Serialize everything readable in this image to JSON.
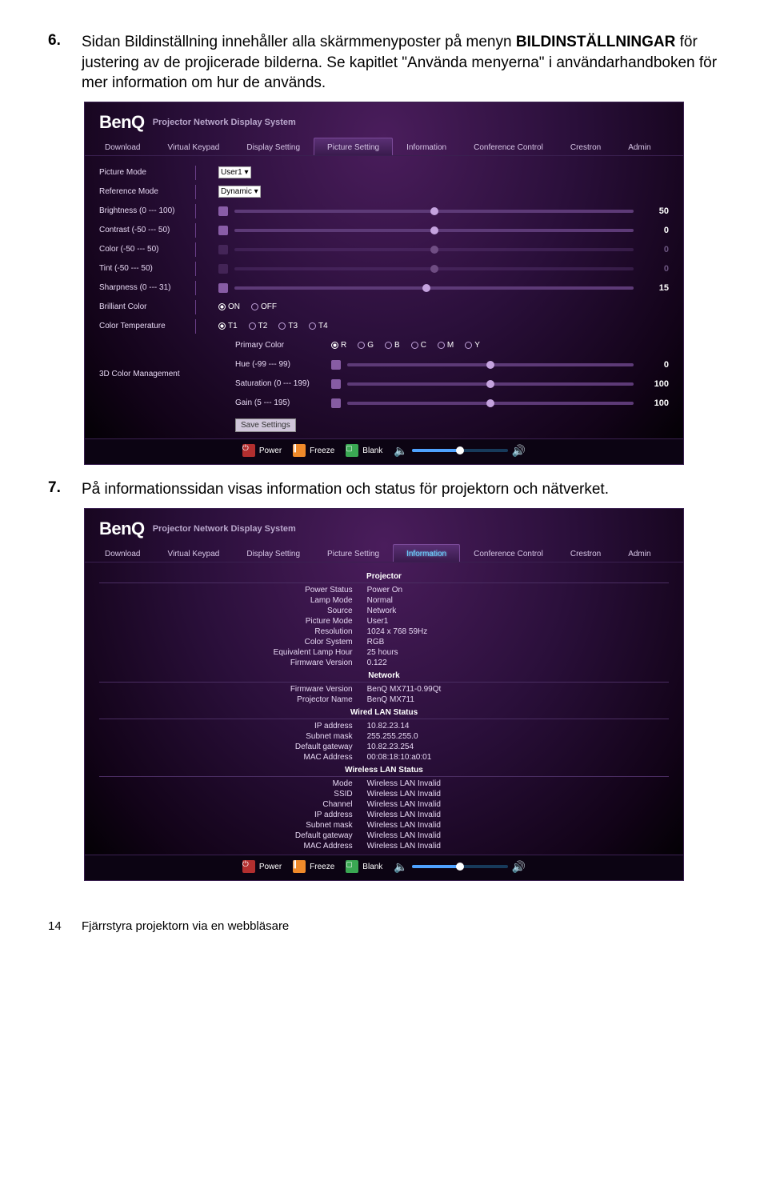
{
  "page": {
    "item6_num": "6.",
    "item6_text_a": "Sidan Bildinställning innehåller alla skärmmenyposter på menyn ",
    "item6_text_b": "BILDINSTÄLLNINGAR",
    "item6_text_c": " för justering av de projicerade bilderna. Se kapitlet \"Använda menyerna\" i användarhandboken för mer information om hur de används.",
    "item7_num": "7.",
    "item7_text": "På informationssidan visas information och status för projektorn och nätverket.",
    "footer_pagenum": "14",
    "footer_chapter": "Fjärrstyra projektorn via en webbläsare"
  },
  "shot1": {
    "logo": "BenQ",
    "subtitle": "Projector Network Display System",
    "tabs": [
      "Download",
      "Virtual Keypad",
      "Display Setting",
      "Picture Setting",
      "Information",
      "Conference Control",
      "Crestron",
      "Admin"
    ],
    "active_tab": "Picture Setting",
    "picture_mode_label": "Picture Mode",
    "picture_mode_value": "User1",
    "reference_mode_label": "Reference Mode",
    "reference_mode_value": "Dynamic",
    "brightness_label": "Brightness (0 --- 100)",
    "brightness_value": "50",
    "contrast_label": "Contrast (-50 --- 50)",
    "contrast_value": "0",
    "color_label": "Color (-50 --- 50)",
    "color_value": "0",
    "tint_label": "Tint (-50 --- 50)",
    "tint_value": "0",
    "sharpness_label": "Sharpness (0 --- 31)",
    "sharpness_value": "15",
    "brilliant_label": "Brilliant Color",
    "brilliant_options": [
      "ON",
      "OFF"
    ],
    "ctemp_label": "Color Temperature",
    "ctemp_options": [
      "T1",
      "T2",
      "T3",
      "T4"
    ],
    "group3d_label": "3D Color Management",
    "primary_label": "Primary Color",
    "primary_options": [
      "R",
      "G",
      "B",
      "C",
      "M",
      "Y"
    ],
    "hue_label": "Hue (-99 --- 99)",
    "hue_value": "0",
    "sat_label": "Saturation (0 --- 199)",
    "sat_value": "100",
    "gain_label": "Gain (5 --- 195)",
    "gain_value": "100",
    "save_label": "Save Settings",
    "footer_power": "Power",
    "footer_freeze": "Freeze",
    "footer_blank": "Blank"
  },
  "shot2": {
    "logo": "BenQ",
    "subtitle": "Projector Network Display System",
    "tabs": [
      "Download",
      "Virtual Keypad",
      "Display Setting",
      "Picture Setting",
      "Information",
      "Conference Control",
      "Crestron",
      "Admin"
    ],
    "active_tab": "Information",
    "h_projector": "Projector",
    "rows_projector": [
      [
        "Power Status",
        "Power On"
      ],
      [
        "Lamp Mode",
        "Normal"
      ],
      [
        "Source",
        "Network"
      ],
      [
        "Picture Mode",
        "User1"
      ],
      [
        "Resolution",
        "1024 x 768 59Hz"
      ],
      [
        "Color System",
        "RGB"
      ],
      [
        "Equivalent Lamp Hour",
        "25 hours"
      ],
      [
        "Firmware Version",
        "0.122"
      ]
    ],
    "h_network": "Network",
    "rows_network": [
      [
        "Firmware Version",
        "BenQ MX711-0.99Qt"
      ],
      [
        "Projector Name",
        "BenQ MX711"
      ]
    ],
    "h_wired": "Wired LAN Status",
    "rows_wired": [
      [
        "IP address",
        "10.82.23.14"
      ],
      [
        "Subnet mask",
        "255.255.255.0"
      ],
      [
        "Default gateway",
        "10.82.23.254"
      ],
      [
        "MAC Address",
        "00:08:18:10:a0:01"
      ]
    ],
    "h_wireless": "Wireless LAN Status",
    "rows_wireless": [
      [
        "Mode",
        "Wireless LAN Invalid"
      ],
      [
        "SSID",
        "Wireless LAN Invalid"
      ],
      [
        "Channel",
        "Wireless LAN Invalid"
      ],
      [
        "IP address",
        "Wireless LAN Invalid"
      ],
      [
        "Subnet mask",
        "Wireless LAN Invalid"
      ],
      [
        "Default gateway",
        "Wireless LAN Invalid"
      ],
      [
        "MAC Address",
        "Wireless LAN Invalid"
      ]
    ],
    "footer_power": "Power",
    "footer_freeze": "Freeze",
    "footer_blank": "Blank"
  }
}
